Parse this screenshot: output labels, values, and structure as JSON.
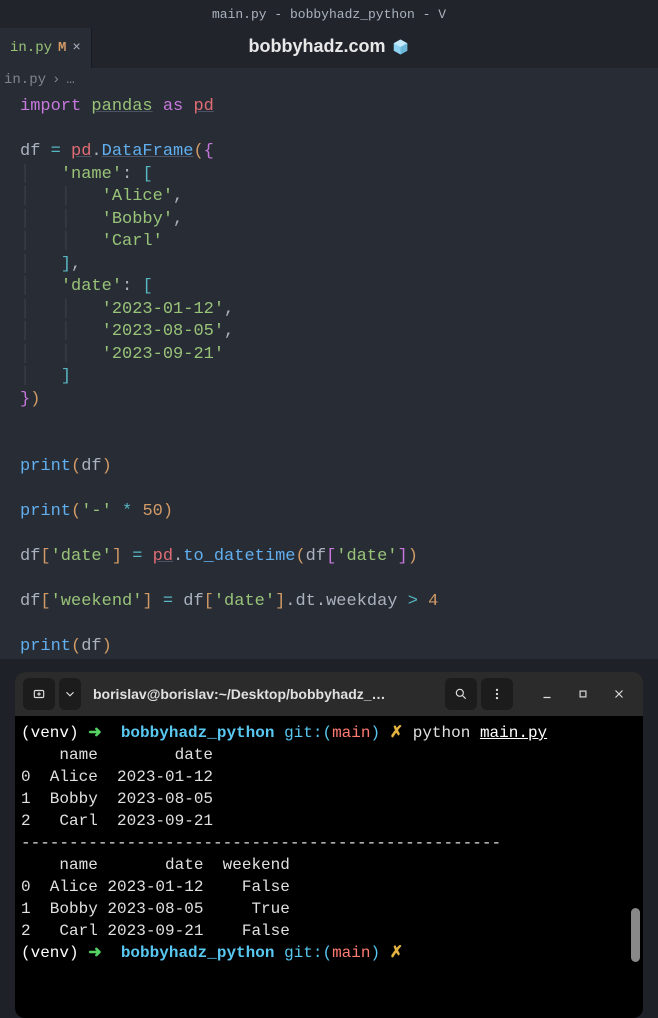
{
  "titlebar": "main.py - bobbyhadz_python - V",
  "tab": {
    "filename": "in.py",
    "modified_badge": "M",
    "close_glyph": "×"
  },
  "overlay": {
    "site": "bobbyhadz.com"
  },
  "breadcrumb": {
    "file": "in.py",
    "sep": "›",
    "dots": "…"
  },
  "code": {
    "kw_import": "import",
    "mod_pandas": "pandas",
    "kw_as": "as",
    "alias_pd": "pd",
    "var_df": "df",
    "eq": "=",
    "pd": "pd",
    "dot": ".",
    "fn_DataFrame": "DataFrame",
    "paren_open": "(",
    "brace_open": "{",
    "key_name": "'name'",
    "colon": ":",
    "bracket_open": "[",
    "val_alice": "'Alice'",
    "val_bobby": "'Bobby'",
    "val_carl": "'Carl'",
    "bracket_close": "]",
    "comma": ",",
    "key_date": "'date'",
    "val_d1": "'2023-01-12'",
    "val_d2": "'2023-08-05'",
    "val_d3": "'2023-09-21'",
    "brace_close": "}",
    "paren_close": ")",
    "fn_print": "print",
    "str_dash": "'-'",
    "star": "*",
    "num_50": "50",
    "idx_date": "'date'",
    "fn_to_dt": "to_datetime",
    "idx_weekend": "'weekend'",
    "prop_dt": "dt",
    "prop_weekday": "weekday",
    "gt": ">",
    "num_4": "4"
  },
  "terminal": {
    "title": "borislav@borislav:~/Desktop/bobbyhadz_…",
    "prompt": {
      "venv": "(venv)",
      "arrow": "➜",
      "dir": "bobbyhadz_python",
      "git_label": "git:(",
      "branch": "main",
      "git_close": ")",
      "dirty": "✗"
    },
    "cmd1": {
      "binary": "python",
      "arg": "main.py"
    },
    "output_lines": [
      "    name        date",
      "0  Alice  2023-01-12",
      "1  Bobby  2023-08-05",
      "2   Carl  2023-09-21",
      "--------------------------------------------------",
      "    name       date  weekend",
      "0  Alice 2023-01-12    False",
      "1  Bobby 2023-08-05     True",
      "2   Carl 2023-09-21    False"
    ]
  }
}
